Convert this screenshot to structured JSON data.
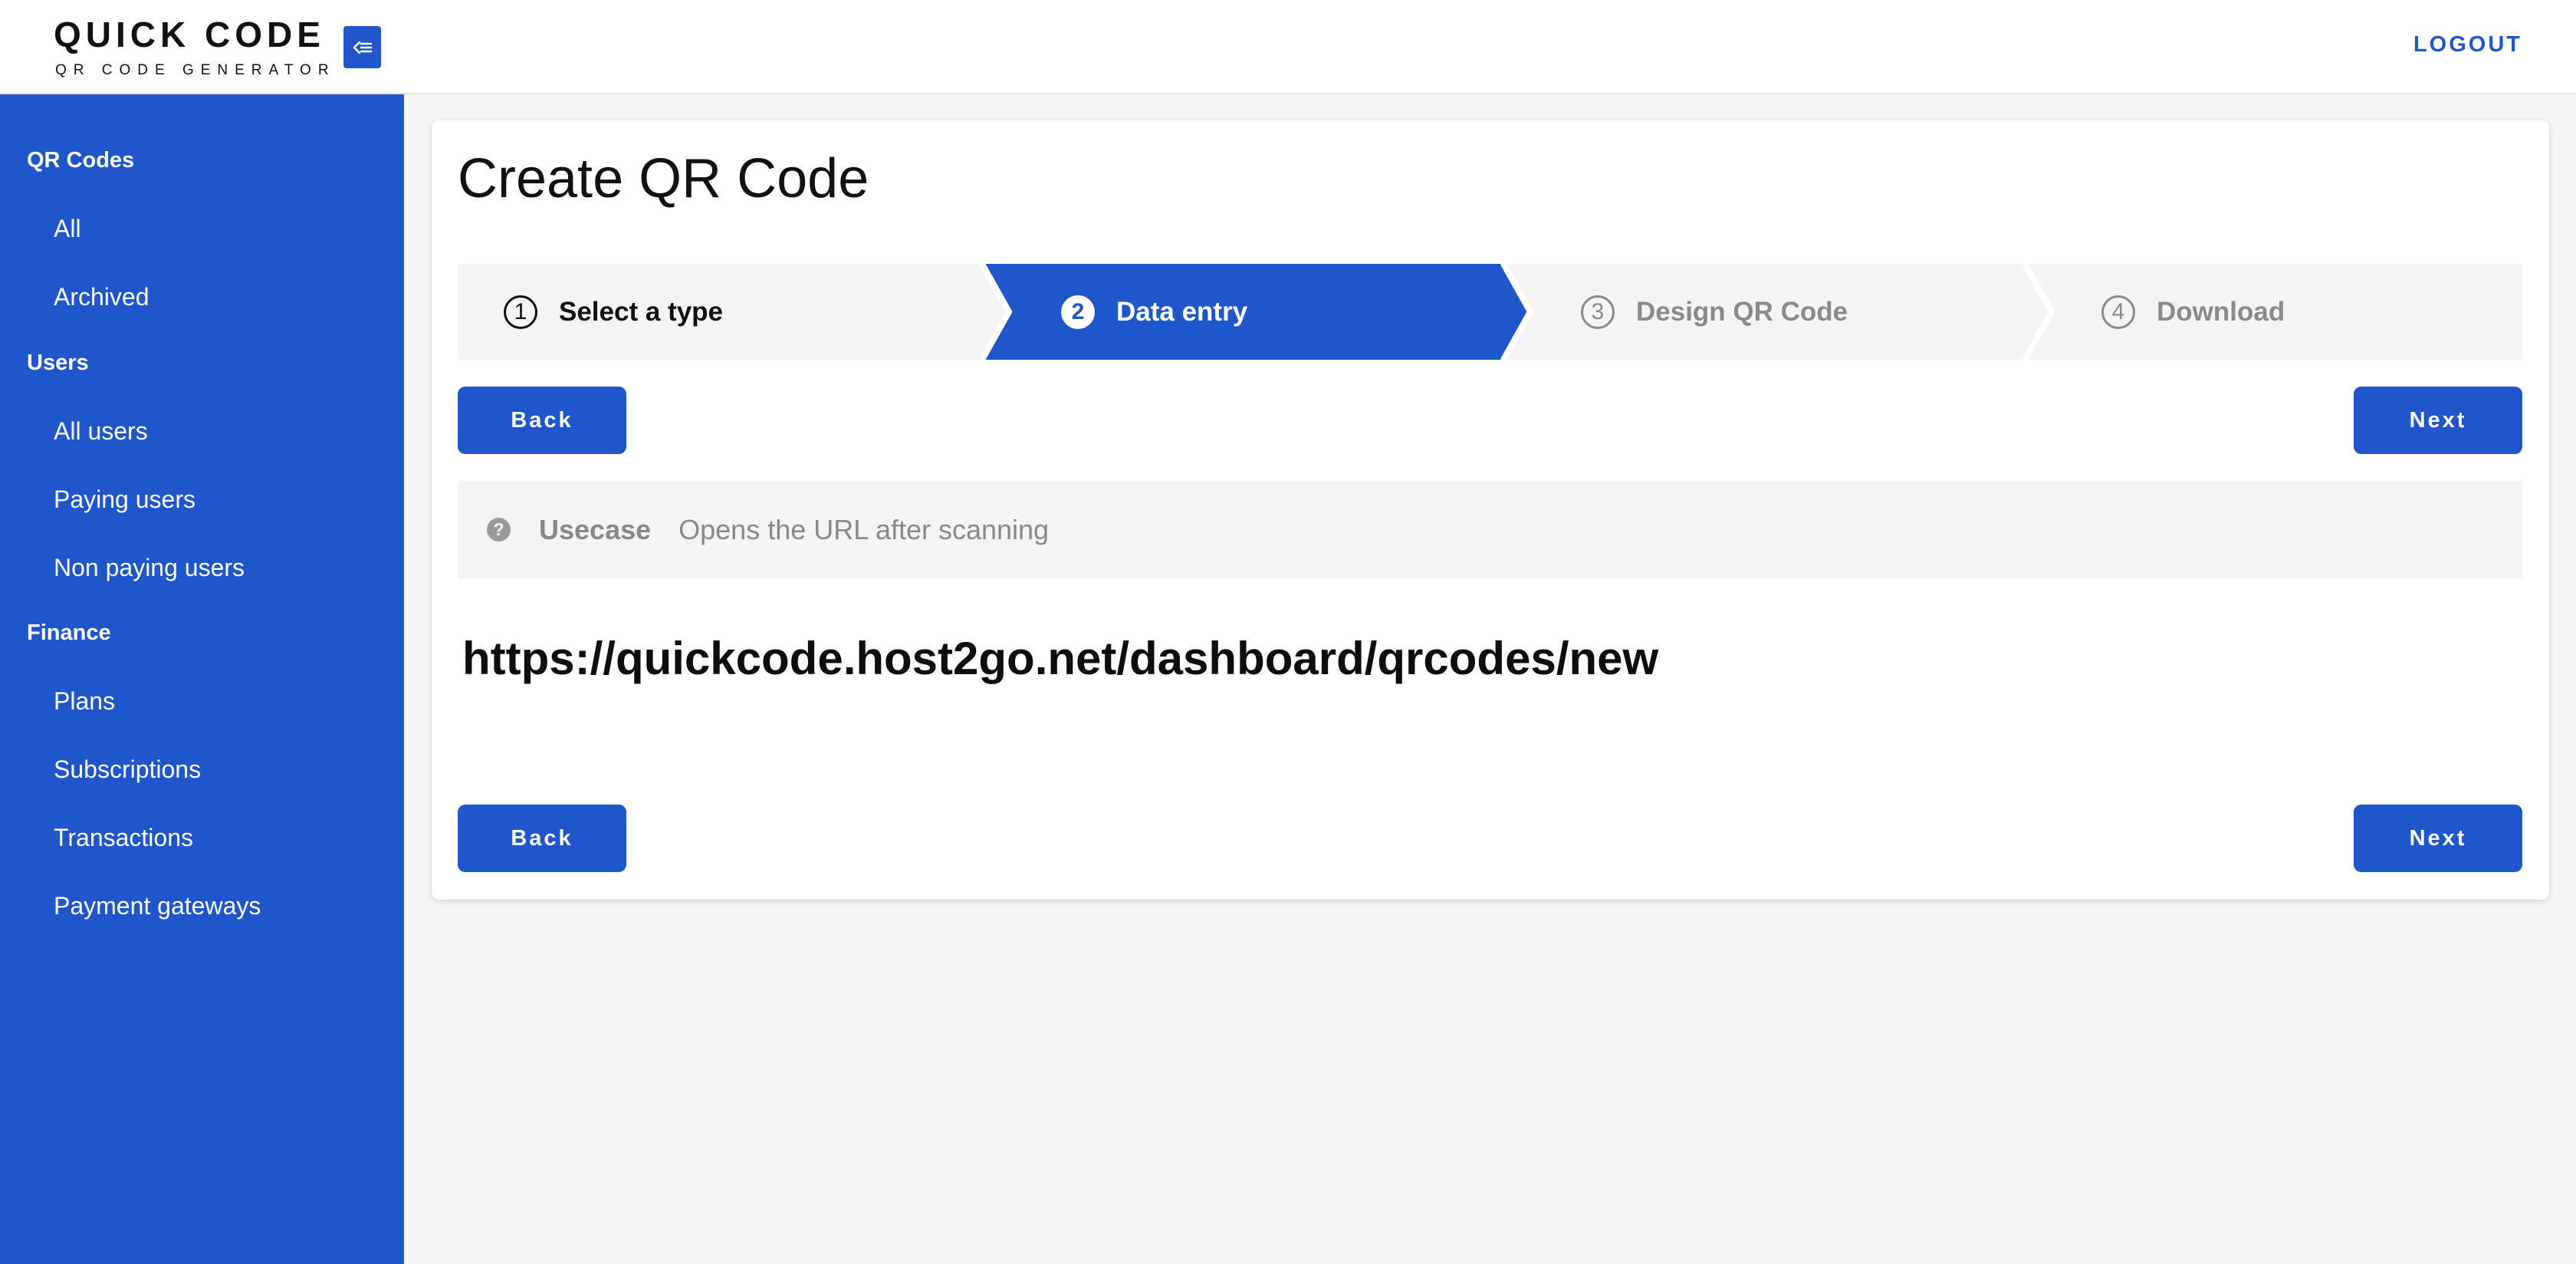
{
  "header": {
    "logo_title": "QUICK CODE",
    "logo_subtitle": "QR CODE GENERATOR",
    "collapse_icon": "collapse-left-icon",
    "logout_label": "LOGOUT"
  },
  "sidebar": {
    "sections": [
      {
        "heading": "QR Codes",
        "items": [
          "All",
          "Archived"
        ]
      },
      {
        "heading": "Users",
        "items": [
          "All users",
          "Paying users",
          "Non paying users"
        ]
      },
      {
        "heading": "Finance",
        "items": [
          "Plans",
          "Subscriptions",
          "Transactions",
          "Payment gateways"
        ]
      }
    ]
  },
  "main": {
    "title": "Create QR Code",
    "steps": [
      {
        "num": "1",
        "label": "Select a type",
        "state": "completed"
      },
      {
        "num": "2",
        "label": "Data entry",
        "state": "active"
      },
      {
        "num": "3",
        "label": "Design QR Code",
        "state": "upcoming"
      },
      {
        "num": "4",
        "label": "Download",
        "state": "upcoming"
      }
    ],
    "back_label": "Back",
    "next_label": "Next",
    "usecase": {
      "icon": "question-circle-icon",
      "label": "Usecase",
      "description": "Opens the URL after scanning"
    },
    "url_value": "https://quickcode.host2go.net/dashboard/qrcodes/new"
  },
  "colors": {
    "brand": "#1f56cc",
    "background": "#f4f4f4",
    "muted_text": "#888888"
  }
}
